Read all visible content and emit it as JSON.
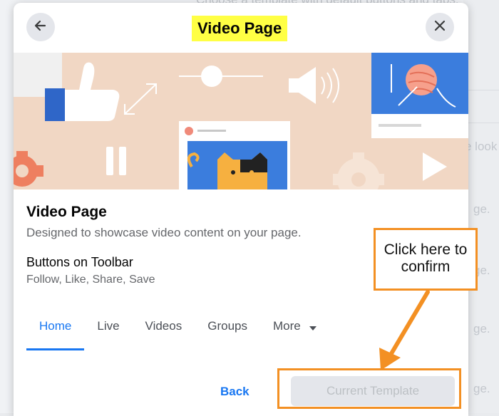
{
  "background": {
    "fragments": [
      "Choose a template with default buttons and tabs.",
      "e look",
      "ge.",
      "ge.",
      "ge.",
      "ge."
    ]
  },
  "dialog": {
    "title": "Video Page",
    "back_icon": "arrow-left-icon",
    "close_icon": "close-icon"
  },
  "template": {
    "name": "Video Page",
    "description": "Designed to showcase video content on your page.",
    "toolbar_heading": "Buttons on Toolbar",
    "toolbar_buttons": "Follow, Like, Share, Save"
  },
  "tabs": [
    {
      "label": "Home",
      "active": true
    },
    {
      "label": "Live",
      "active": false
    },
    {
      "label": "Videos",
      "active": false
    },
    {
      "label": "Groups",
      "active": false
    },
    {
      "label": "More",
      "active": false,
      "icon": "caret-down-icon"
    }
  ],
  "footer": {
    "back_label": "Back",
    "current_template_label": "Current Template"
  },
  "annotation": {
    "callout_line1": "Click here to",
    "callout_line2": "confirm",
    "color": "#f39023"
  },
  "colors": {
    "accent": "#1877f2",
    "title_highlight": "#ffff44",
    "hero_bg": "#f1d7c4",
    "hero_blue": "#3b7ddd"
  }
}
